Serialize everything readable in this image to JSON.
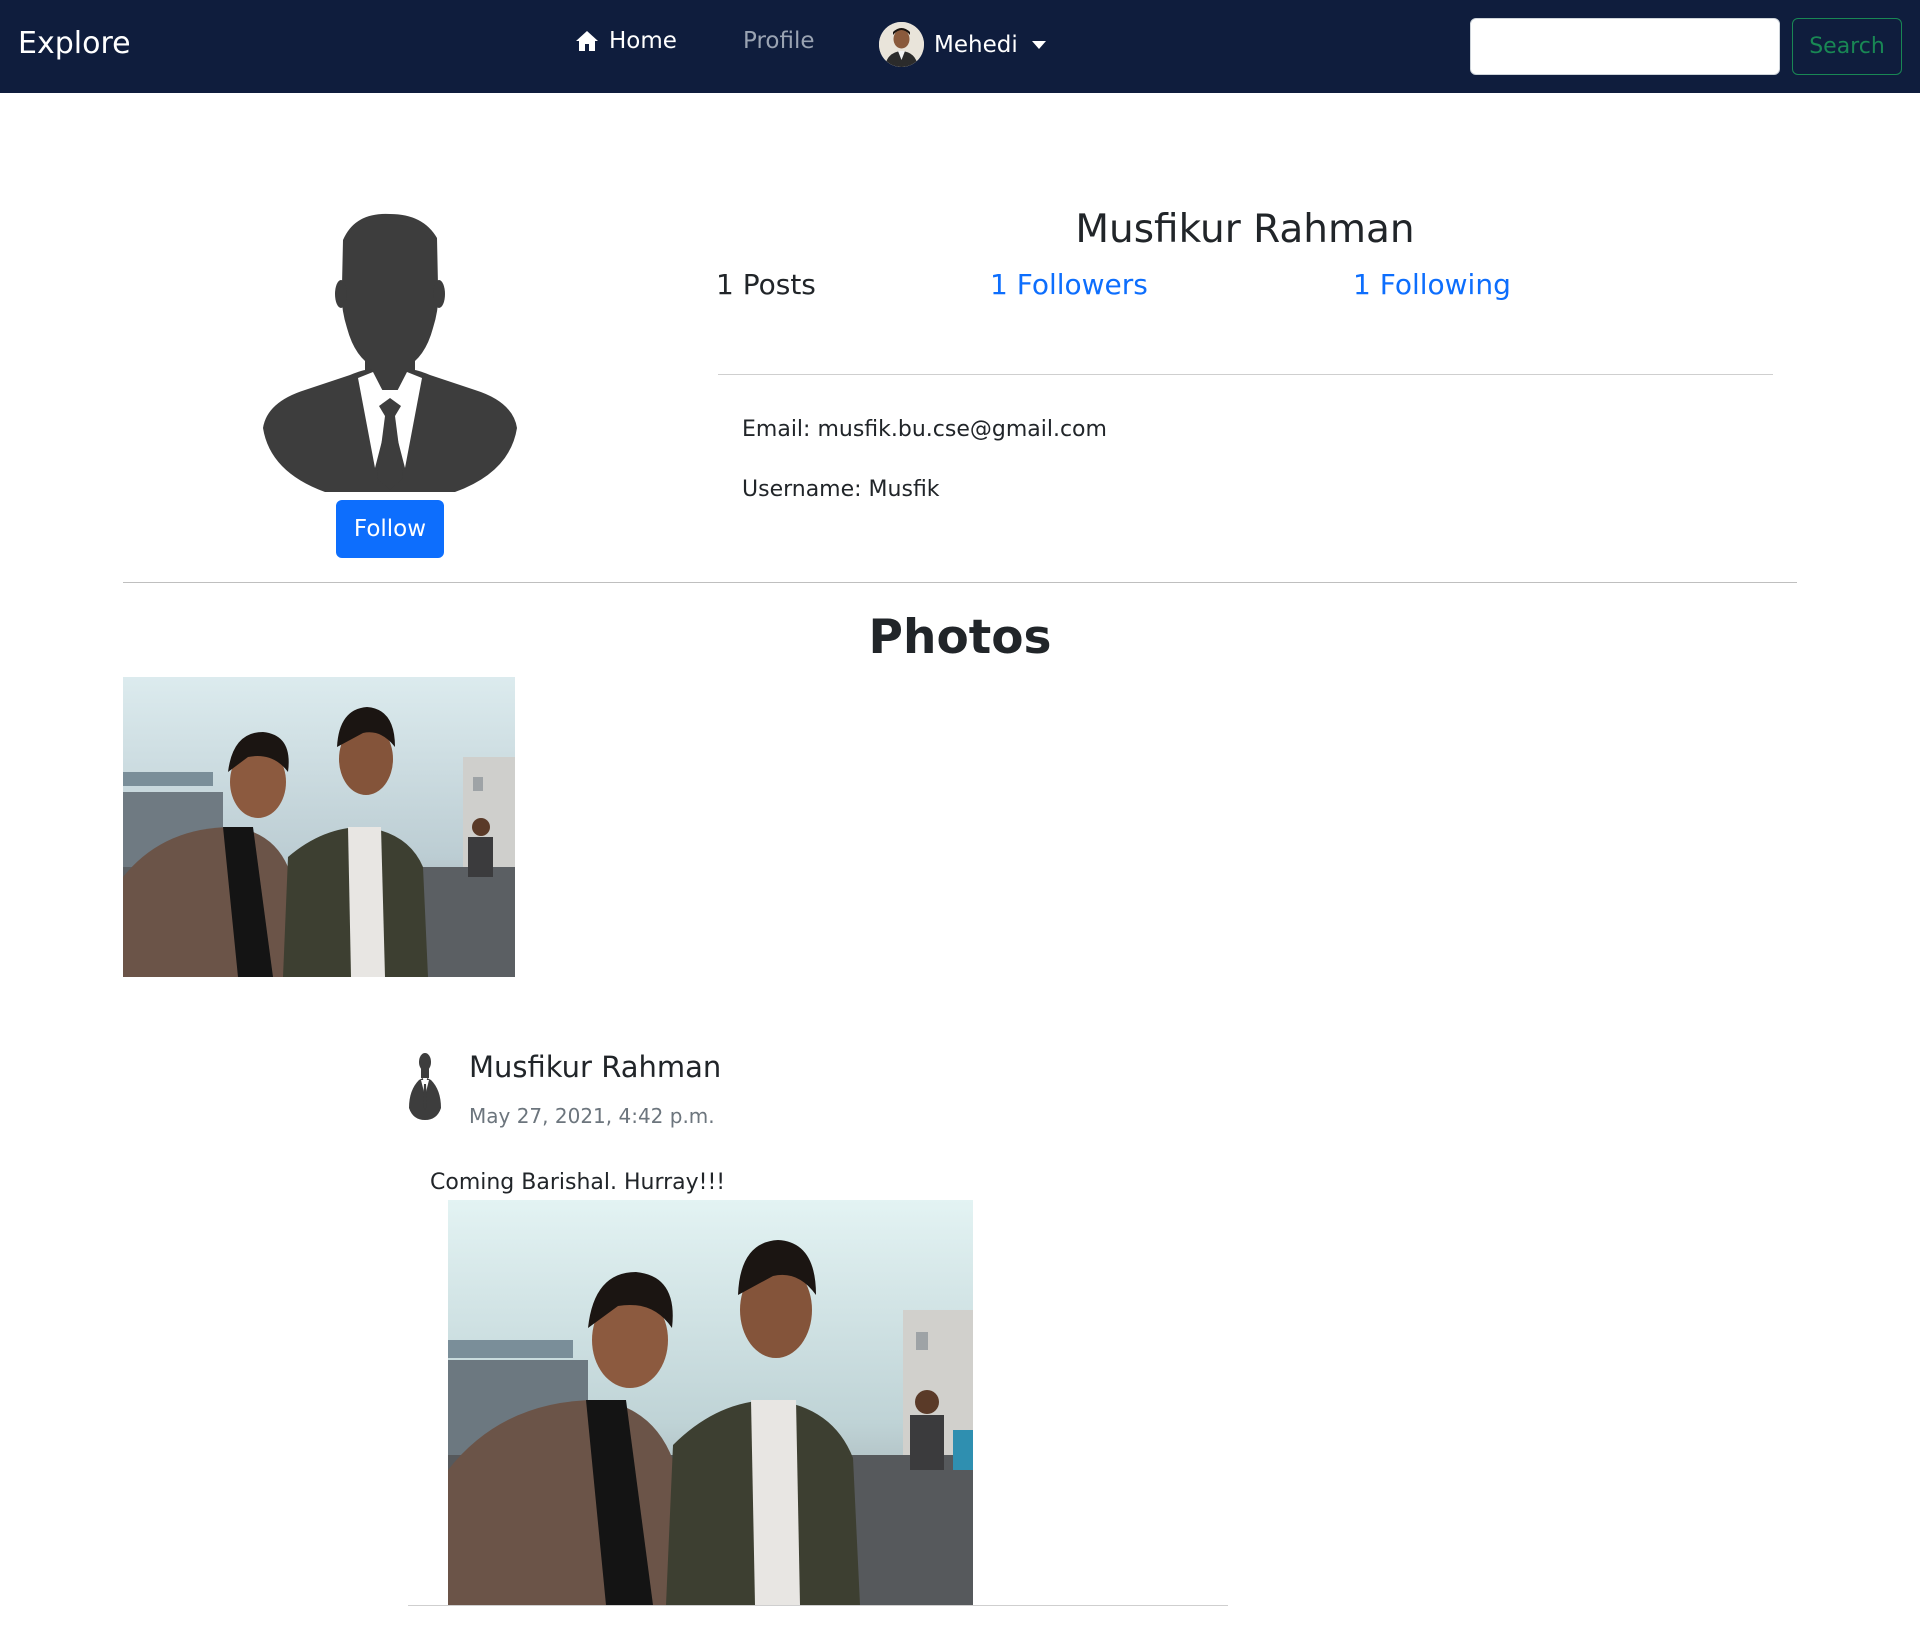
{
  "navbar": {
    "brand": "Explore",
    "home_label": "Home",
    "home_icon": "house-icon",
    "profile_label": "Profile",
    "user_name": "Mehedi",
    "search_value": "",
    "search_button": "Search"
  },
  "profile": {
    "name": "Musfikur Rahman",
    "posts": "1 Posts",
    "followers": "1 Followers",
    "following": "1 Following",
    "follow_button": "Follow",
    "email": "Email: musfik.bu.cse@gmail.com",
    "username": "Username: Musfik"
  },
  "photos": {
    "title": "Photos"
  },
  "post": {
    "author": "Musfikur Rahman",
    "date": "May 27, 2021, 4:42 p.m.",
    "text": "Coming Barishal. Hurray!!!"
  },
  "colors": {
    "navbar_bg": "#0f1d3d",
    "primary": "#0d6efd",
    "success": "#198754"
  }
}
